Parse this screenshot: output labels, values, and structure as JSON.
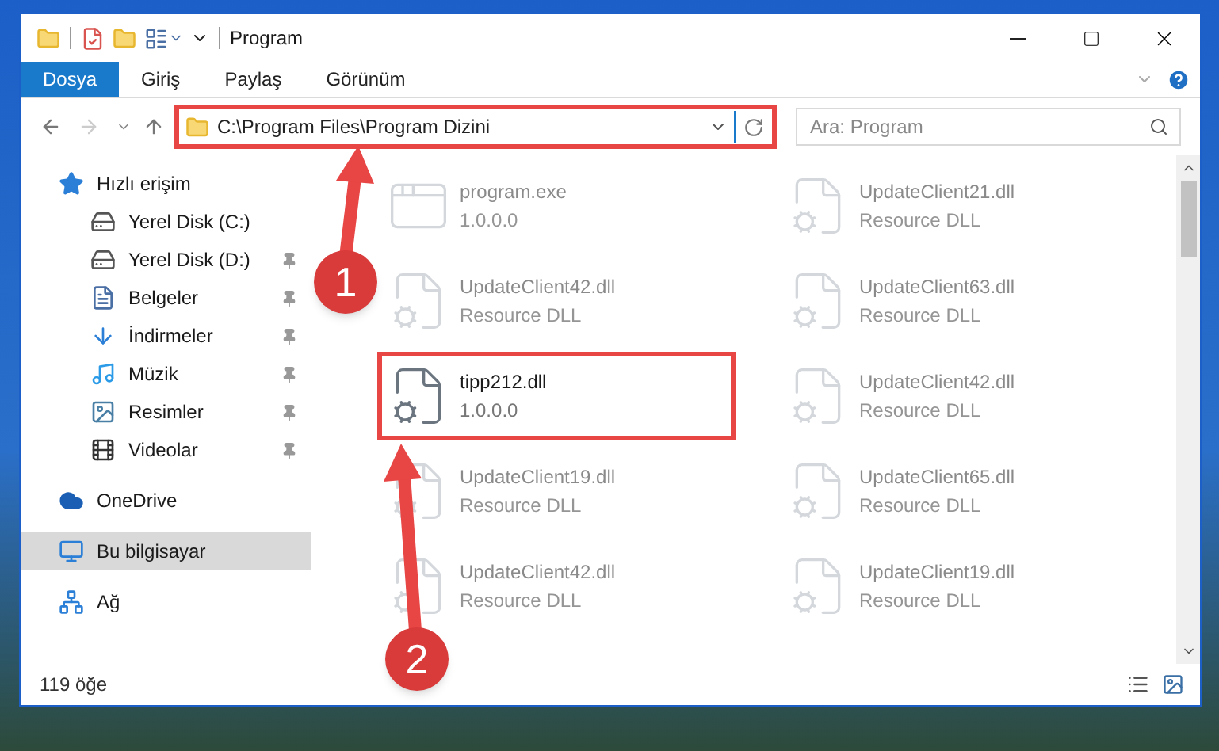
{
  "window": {
    "title": "Program"
  },
  "ribbon_tabs": [
    {
      "label": "Dosya",
      "selected": true
    },
    {
      "label": "Giriş",
      "selected": false
    },
    {
      "label": "Paylaş",
      "selected": false
    },
    {
      "label": "Görünüm",
      "selected": false
    }
  ],
  "address_bar": {
    "path": "C:\\Program Files\\Program Dizini",
    "highlighted": true
  },
  "search": {
    "placeholder": "Ara: Program"
  },
  "nav_pane": {
    "items": [
      {
        "label": "Hızlı erişim",
        "kind": "quick-access",
        "selected": false,
        "children": [
          {
            "label": "Yerel Disk (C:)",
            "kind": "system-drive",
            "pinned": false
          },
          {
            "label": "Yerel Disk (D:)",
            "kind": "drive",
            "pinned": true
          },
          {
            "label": "Belgeler",
            "kind": "documents",
            "pinned": true
          },
          {
            "label": "İndirmeler",
            "kind": "downloads",
            "pinned": true
          },
          {
            "label": "Müzik",
            "kind": "music",
            "pinned": true
          },
          {
            "label": "Resimler",
            "kind": "pictures",
            "pinned": true
          },
          {
            "label": "Videolar",
            "kind": "videos",
            "pinned": true
          }
        ]
      },
      {
        "label": "OneDrive",
        "kind": "cloud",
        "selected": false
      },
      {
        "label": "Bu bilgisayar",
        "kind": "computer",
        "selected": true
      },
      {
        "label": "Ağ",
        "kind": "network",
        "selected": false
      }
    ]
  },
  "files": [
    {
      "name": "program.exe",
      "detail": "1.0.0.0",
      "kind": "exe",
      "faded": true,
      "highlighted": false
    },
    {
      "name": "UpdateClient21.dll",
      "detail": "Resource DLL",
      "kind": "dll",
      "faded": true,
      "highlighted": false
    },
    {
      "name": "UpdateClient42.dll",
      "detail": "Resource DLL",
      "kind": "dll",
      "faded": true,
      "highlighted": false
    },
    {
      "name": "UpdateClient63.dll",
      "detail": "Resource DLL",
      "kind": "dll",
      "faded": true,
      "highlighted": false
    },
    {
      "name": "tipp212.dll",
      "detail": "1.0.0.0",
      "kind": "dll",
      "faded": false,
      "highlighted": true
    },
    {
      "name": "UpdateClient42.dll",
      "detail": "Resource DLL",
      "kind": "dll",
      "faded": true,
      "highlighted": false
    },
    {
      "name": "UpdateClient19.dll",
      "detail": "Resource DLL",
      "kind": "dll",
      "faded": true,
      "highlighted": false
    },
    {
      "name": "UpdateClient65.dll",
      "detail": "Resource DLL",
      "kind": "dll",
      "faded": true,
      "highlighted": false
    },
    {
      "name": "UpdateClient42.dll",
      "detail": "Resource DLL",
      "kind": "dll",
      "faded": true,
      "highlighted": false
    },
    {
      "name": "UpdateClient19.dll",
      "detail": "Resource DLL",
      "kind": "dll",
      "faded": true,
      "highlighted": false
    }
  ],
  "status_bar": {
    "item_count": "119 öğe"
  },
  "annotations": [
    {
      "number": "1"
    },
    {
      "number": "2"
    }
  ]
}
